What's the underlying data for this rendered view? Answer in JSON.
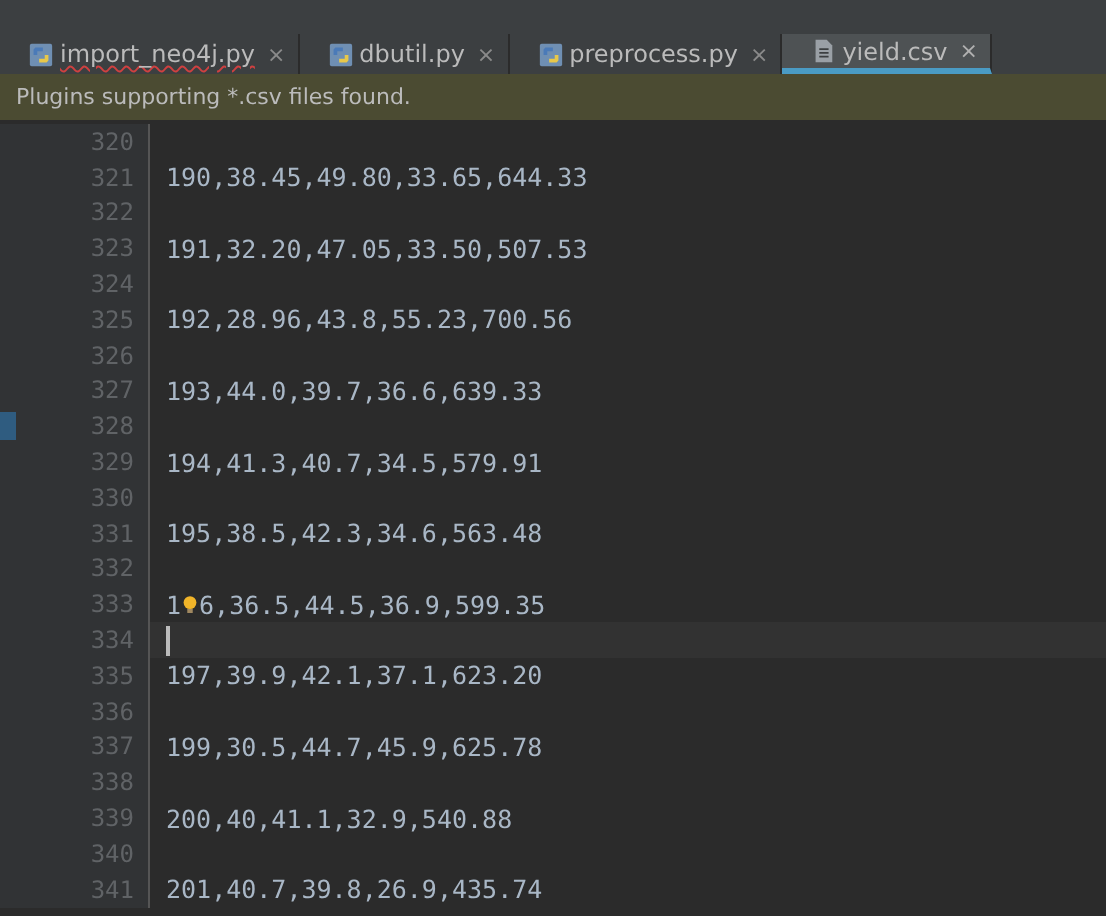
{
  "tabs": [
    {
      "label": "import_neo4j.py",
      "kind": "python",
      "selected": false,
      "error": true,
      "close": "×"
    },
    {
      "label": "dbutil.py",
      "kind": "python",
      "selected": false,
      "error": false,
      "close": "×"
    },
    {
      "label": "preprocess.py",
      "kind": "python",
      "selected": false,
      "error": false,
      "close": "×"
    },
    {
      "label": "yield.csv",
      "kind": "text",
      "selected": true,
      "error": false,
      "close": "×"
    }
  ],
  "banner": {
    "text": "Plugins supporting *.csv files found."
  },
  "editor": {
    "lines": [
      {
        "number": "320",
        "current": false
      },
      {
        "number": "321",
        "text": "190,38.45,49.80,33.65,644.33",
        "current": false
      },
      {
        "number": "322",
        "current": false
      },
      {
        "number": "323",
        "text": "191,32.20,47.05,33.50,507.53",
        "current": false
      },
      {
        "number": "324",
        "current": false
      },
      {
        "number": "325",
        "text": "192,28.96,43.8,55.23,700.56",
        "current": false
      },
      {
        "number": "326",
        "current": false
      },
      {
        "number": "327",
        "text": "193,44.0,39.7,36.6,639.33",
        "current": false
      },
      {
        "number": "328",
        "current": false
      },
      {
        "number": "329",
        "text": "194,41.3,40.7,34.5,579.91",
        "current": false
      },
      {
        "number": "330",
        "current": false
      },
      {
        "number": "331",
        "text": "195,38.5,42.3,34.6,563.48",
        "current": false
      },
      {
        "number": "332",
        "current": false
      },
      {
        "number": "333",
        "text": "1",
        "after_bulb": "6,36.5,44.5,36.9,599.35",
        "current": false
      },
      {
        "number": "334",
        "current": true
      },
      {
        "number": "335",
        "text": "197,39.9,42.1,37.1,623.20",
        "current": false
      },
      {
        "number": "336",
        "current": false
      },
      {
        "number": "337",
        "text": "199,30.5,44.7,45.9,625.78",
        "current": false
      },
      {
        "number": "338",
        "current": false
      },
      {
        "number": "339",
        "text": "200,40,41.1,32.9,540.88",
        "current": false
      },
      {
        "number": "340",
        "current": false
      },
      {
        "number": "341",
        "text": "201,40.7,39.8,26.9,435.74",
        "current": false
      }
    ]
  }
}
